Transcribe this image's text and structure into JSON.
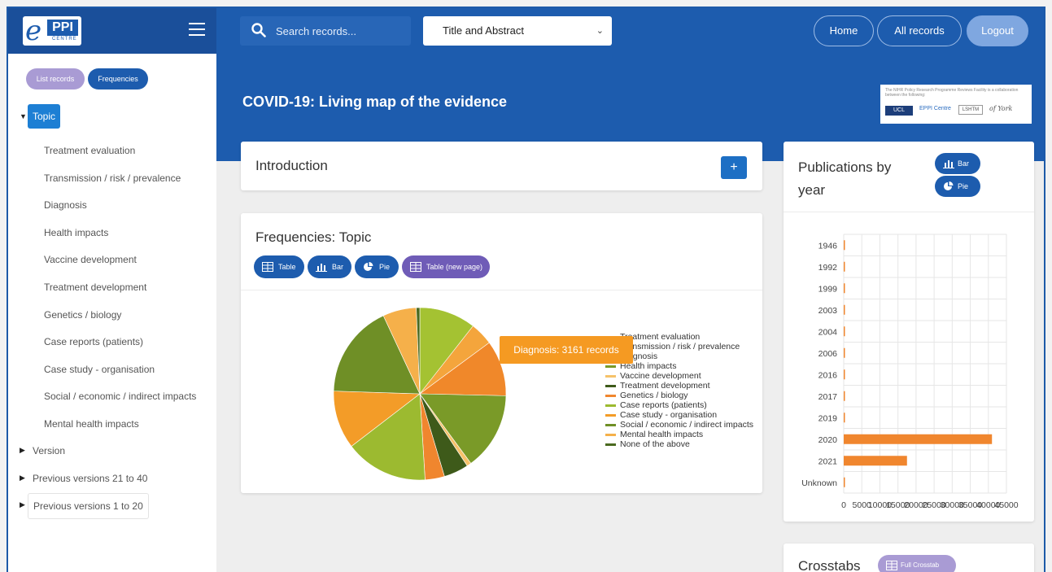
{
  "topbar": {
    "logo_text": "PPI",
    "logo_sub": "CENTRE",
    "search_placeholder": "Search records...",
    "search_field": "Title and Abstract",
    "nav": {
      "home": "Home",
      "all_records": "All records",
      "logout": "Logout"
    }
  },
  "sidebar": {
    "list_records": "List records",
    "frequencies": "Frequencies",
    "topic": "Topic",
    "topic_items": [
      "Treatment evaluation",
      "Transmission / risk / prevalence",
      "Diagnosis",
      "Health impacts",
      "Vaccine development",
      "Treatment development",
      "Genetics / biology",
      "Case reports (patients)",
      "Case study - organisation",
      "Social / economic / indirect impacts",
      "Mental health impacts"
    ],
    "groups": [
      "Version",
      "Previous versions 21 to 40",
      "Previous versions 1 to 20"
    ]
  },
  "main": {
    "title": "COVID-19: Living map of the evidence",
    "partner_text": "The NIHR Policy Research Programme Reviews Facility is a collaboration between the following:",
    "partner_ucl": "UCL",
    "partner_eppi": "EPPI Centre",
    "partner_york": "of York",
    "introduction": "Introduction",
    "intro_plus": "+",
    "freq_title": "Frequencies:  Topic",
    "freq_buttons": {
      "table": "Table",
      "bar": "Bar",
      "pie": "Pie",
      "table_new": "Table (new page)"
    },
    "tooltip": "Diagnosis: 3161 records",
    "pub_title": "Publications by year",
    "pub_buttons": {
      "bar": "Bar",
      "pie": "Pie"
    },
    "crosstabs": "Crosstabs",
    "full_crosstab": "Full Crosstab"
  },
  "colors": {
    "brand_blue": "#1d5cae",
    "purple": "#6f5cb7",
    "orange": "#f59a22",
    "bar_orange": "#f0862e"
  },
  "chart_data": [
    {
      "type": "pie",
      "title": "",
      "labels": [
        "Treatment evaluation",
        "Transmission / risk / prevalence",
        "Diagnosis",
        "Health impacts",
        "Vaccine development",
        "Treatment development",
        "Genetics / biology",
        "Case reports (patients)",
        "Case study - organisation",
        "Social / economic / indirect impacts",
        "Mental health impacts",
        "None of the above"
      ],
      "values": [
        3200,
        1300,
        3161,
        4400,
        250,
        1400,
        1100,
        4700,
        3300,
        5300,
        1900,
        200
      ],
      "colors": [
        "#a4c232",
        "#f4a53c",
        "#f0882a",
        "#7a9a28",
        "#f6c26a",
        "#3e5a1a",
        "#f0862e",
        "#9cba30",
        "#f39c28",
        "#6f8f26",
        "#f5b04a",
        "#4a6a20"
      ],
      "legend": "right"
    },
    {
      "type": "bar",
      "orientation": "horizontal",
      "categories": [
        "1946",
        "1992",
        "1999",
        "2003",
        "2004",
        "2006",
        "2016",
        "2017",
        "2019",
        "2020",
        "2021",
        "Unknown"
      ],
      "values": [
        1,
        1,
        1,
        1,
        1,
        1,
        2,
        3,
        10,
        41000,
        17500,
        15
      ],
      "xlim": [
        0,
        45000
      ],
      "xticks": [
        "0",
        "5000",
        "10000",
        "15000",
        "20000",
        "25000",
        "30000",
        "35000",
        "40000",
        "45000"
      ],
      "grid": true
    }
  ]
}
